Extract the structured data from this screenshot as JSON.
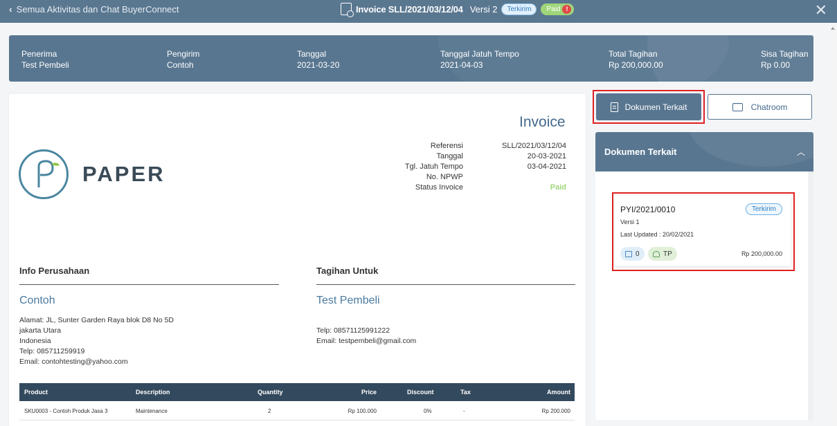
{
  "topbar": {
    "back_label": "Semua Aktivitas dan Chat BuyerConnect",
    "title": "Invoice SLL/2021/03/12/04",
    "version": "Versi 2",
    "status_sent": "Terkirim",
    "status_paid": "Paid",
    "paid_alert": "!"
  },
  "summary": [
    {
      "label": "Penerima",
      "value": "Test Pembeli"
    },
    {
      "label": "Pengirim",
      "value": "Contoh"
    },
    {
      "label": "Tanggal",
      "value": "2021-03-20"
    },
    {
      "label": "Tanggal Jatuh Tempo",
      "value": "2021-04-03"
    },
    {
      "label": "Total Tagihan",
      "value": "Rp 200,000.00"
    },
    {
      "label": "Sisa Tagihan",
      "value": "Rp 0.00"
    }
  ],
  "invoice": {
    "title": "Invoice",
    "logo_text": "PAPER",
    "meta": [
      {
        "label": "Referensi",
        "value": "SLL/2021/03/12/04"
      },
      {
        "label": "Tanggal",
        "value": "20-03-2021"
      },
      {
        "label": "Tgl. Jatuh Tempo",
        "value": "03-04-2021"
      },
      {
        "label": "No. NPWP",
        "value": ""
      },
      {
        "label": "Status Invoice",
        "value": "Paid"
      }
    ],
    "seller": {
      "section_title": "Info Perusahaan",
      "name": "Contoh",
      "lines": [
        "Alamat: JL, Sunter Garden Raya blok D8 No 5D",
        "jakarta Utara",
        "Indonesia",
        "Telp: 085711259919",
        "Email: contohtesting@yahoo.com"
      ]
    },
    "buyer": {
      "section_title": "Tagihan Untuk",
      "name": "Test Pembeli",
      "lines": [
        "Telp: 08571125991222",
        "Email: testpembeli@gmail.com"
      ]
    },
    "table": {
      "headers": [
        "Product",
        "Description",
        "Quantity",
        "Price",
        "Discount",
        "Tax",
        "Amount"
      ],
      "rows": [
        [
          "SKU0003 - Contoh Produk Jasa 3",
          "Maintenance",
          "2",
          "Rp 100.000",
          "0%",
          "-",
          "Rp 200.000"
        ]
      ]
    }
  },
  "side": {
    "btn_dokumen": "Dokumen Terkait",
    "btn_chat": "Chatroom",
    "panel_title": "Dokumen Terkait",
    "card": {
      "id": "PYI/2021/0010",
      "status": "Terkirim",
      "version": "Versi 1",
      "updated_label": "Last Updated : ",
      "updated_value": "20/02/2021",
      "chip_count": "0",
      "chip_user": "TP",
      "amount": "Rp 200,000.00"
    }
  }
}
